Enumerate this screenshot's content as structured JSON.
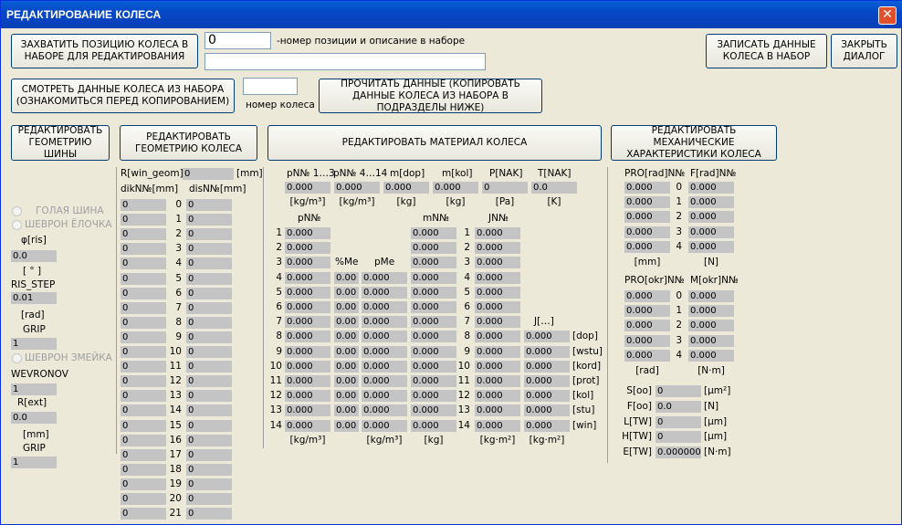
{
  "window": {
    "title": "РЕДАКТИРОВАНИЕ КОЛЕСА",
    "close": "✕"
  },
  "top": {
    "capture_btn": "ЗАХВАТИТЬ ПОЗИЦИЮ КОЛЕСА В НАБОРЕ ДЛЯ РЕДАКТИРОВАНИЯ",
    "pos_value": "0",
    "pos_label": "-номер позиции и описание в наборе",
    "desc_value": "",
    "view_btn": "СМОТРЕТЬ ДАННЫЕ КОЛЕСА ИЗ НАБОРА (ОЗНАКОМИТЬСЯ ПЕРЕД КОПИРОВАНИЕМ)",
    "wheel_num_value": "",
    "wheel_num_label": "номер колеса",
    "read_btn": "ПРОЧИТАТЬ ДАННЫЕ (КОПИРОВАТЬ ДАННЫЕ КОЛЕСА ИЗ НАБОРА В ПОДРАЗДЕЛЫ НИЖЕ)",
    "write_btn": "ЗАПИСАТЬ ДАННЫЕ КОЛЕСА В НАБОР",
    "close_btn": "ЗАКРЫТЬ ДИАЛОГ"
  },
  "section_btns": {
    "tire": "РЕДАКТИРОВАТЬ ГЕОМЕТРИЮ ШИНЫ",
    "wheel": "РЕДАКТИРОВАТЬ ГЕОМЕТРИЮ КОЛЕСА",
    "material": "РЕДАКТИРОВАТЬ МАТЕРИАЛ КОЛЕСА",
    "mech": "РЕДАКТИРОВАТЬ МЕХАНИЧЕСКИЕ ХАРАКТЕРИСТИКИ КОЛЕСА"
  },
  "tire": {
    "radio1": "ГОЛАЯ ШИНА",
    "radio2": "ШЕВРОН ЁЛОЧКА",
    "phi_label": "φ[ris]",
    "phi_value": "0.0",
    "phi_unit": "[ ° ]",
    "risstep_label": "RIS_STEP",
    "risstep_value": "0.01",
    "risstep_unit": "[rad]",
    "grip_label": "GRIP",
    "grip_value": "1",
    "radio3": "ШЕВРОН ЗМЕЙКА",
    "wevronov_label": "WEVRONOV",
    "wevronov_value": "1",
    "rext_label": "R[ext]",
    "rext_value": "0.0",
    "rext_unit": "[mm]",
    "grip2_label": "GRIP",
    "grip2_value": "1"
  },
  "wheel": {
    "rwin_label": "R[win_geom]",
    "rwin_value": "0",
    "rwin_unit": "[mm]",
    "dik_header": "dikN№[mm]",
    "dis_header": "disN№[mm]",
    "dik": [
      "0",
      "0",
      "0",
      "0",
      "0",
      "0",
      "0",
      "0",
      "0",
      "0",
      "0",
      "0",
      "0",
      "0",
      "0",
      "0",
      "0",
      "0",
      "0",
      "0",
      "0",
      "0"
    ],
    "idx": [
      "0",
      "1",
      "2",
      "3",
      "4",
      "5",
      "6",
      "7",
      "8",
      "9",
      "10",
      "11",
      "12",
      "13",
      "14",
      "15",
      "16",
      "17",
      "18",
      "19",
      "20",
      "21"
    ],
    "dis": [
      "0",
      "0",
      "0",
      "0",
      "0",
      "0",
      "0",
      "0",
      "0",
      "0",
      "0",
      "0",
      "0",
      "0",
      "0",
      "0",
      "0",
      "0",
      "0",
      "0",
      "0",
      "0"
    ]
  },
  "material": {
    "hdr": {
      "p13": "pN№ 1…3",
      "p414": "pN№ 4…14",
      "mdop": "m[dop]",
      "mkol": "m[kol]",
      "pnak": "P[NAK]",
      "tnak": "T[NAK]"
    },
    "vals": {
      "p13": "0.000",
      "p414": "0.000",
      "mdop": "0.000",
      "mkol": "0.000",
      "pnak": "0",
      "tnak": "0.0"
    },
    "units": {
      "p13": "[kg/m³]",
      "p414": "[kg/m³]",
      "mdop": "[kg]",
      "mkol": "[kg]",
      "pnak": "[Pa]",
      "tnak": "[K]"
    },
    "col_pN": "pN№",
    "col_mN": "mN№",
    "col_JN": "JN№",
    "col_pctme": "%Me",
    "col_pme": "pMe",
    "col_J": "J[…]",
    "idx": [
      "1",
      "2",
      "3",
      "4",
      "5",
      "6",
      "7",
      "8",
      "9",
      "10",
      "11",
      "12",
      "13",
      "14"
    ],
    "p": [
      "0.000",
      "0.000",
      "0.000",
      "0.000",
      "0.000",
      "0.000",
      "0.000",
      "0.000",
      "0.000",
      "0.000",
      "0.000",
      "0.000",
      "0.000",
      "0.000"
    ],
    "pct": [
      "0.00",
      "0.00",
      "0.00",
      "0.00",
      "0.00",
      "0.00",
      "0.00",
      "0.00",
      "0.00",
      "0.00",
      "0.00"
    ],
    "pme": [
      "0.000",
      "0.000",
      "0.000",
      "0.000",
      "0.000",
      "0.000",
      "0.000",
      "0.000",
      "0.000",
      "0.000",
      "0.000"
    ],
    "m": [
      "0.000",
      "0.000",
      "0.000",
      "0.000",
      "0.000",
      "0.000",
      "0.000",
      "0.000",
      "0.000",
      "0.000",
      "0.000",
      "0.000",
      "0.000",
      "0.000"
    ],
    "j": [
      "0.000",
      "0.000",
      "0.000",
      "0.000",
      "0.000",
      "0.000",
      "0.000",
      "0.000",
      "0.000",
      "0.000",
      "0.000",
      "0.000",
      "0.000",
      "0.000"
    ],
    "jx": [
      "0.000",
      "0.000",
      "0.000",
      "0.000",
      "0.000",
      "0.000",
      "0.000"
    ],
    "jx_lbl": [
      "[dop]",
      "[wstu]",
      "[kord]",
      "[prot]",
      "[kol]",
      "[stu]",
      "[win]"
    ],
    "units_bottom": [
      "[kg/m³]",
      "[kg/m³]",
      "[kg]",
      "[kg·m²]",
      "[kg·m²]"
    ]
  },
  "mech": {
    "pro_rad_hdr": "PRO[rad]N№",
    "f_rad_hdr": "F[rad]N№",
    "pro_rad": [
      "0.000",
      "0.000",
      "0.000",
      "0.000",
      "0.000"
    ],
    "f_rad": [
      "0.000",
      "0.000",
      "0.000",
      "0.000",
      "0.000"
    ],
    "idx": [
      "0",
      "1",
      "2",
      "3",
      "4"
    ],
    "rad_units": [
      "[mm]",
      "[N]"
    ],
    "pro_okr_hdr": "PRO[okr]N№",
    "m_okr_hdr": "M[okr]N№",
    "pro_okr": [
      "0.000",
      "0.000",
      "0.000",
      "0.000",
      "0.000"
    ],
    "m_okr": [
      "0.000",
      "0.000",
      "0.000",
      "0.000",
      "0.000"
    ],
    "okr_units": [
      "[rad]",
      "[N·m]"
    ],
    "extra": [
      {
        "label": "S[oo]",
        "value": "0",
        "unit": "[µm²]"
      },
      {
        "label": "F[oo]",
        "value": "0.0",
        "unit": "[N]"
      },
      {
        "label": "L[TW]",
        "value": "0",
        "unit": "[µm]"
      },
      {
        "label": "H[TW]",
        "value": "0",
        "unit": "[µm]"
      },
      {
        "label": "E[TW]",
        "value": "0.000000",
        "unit": "[N·m]"
      }
    ]
  }
}
